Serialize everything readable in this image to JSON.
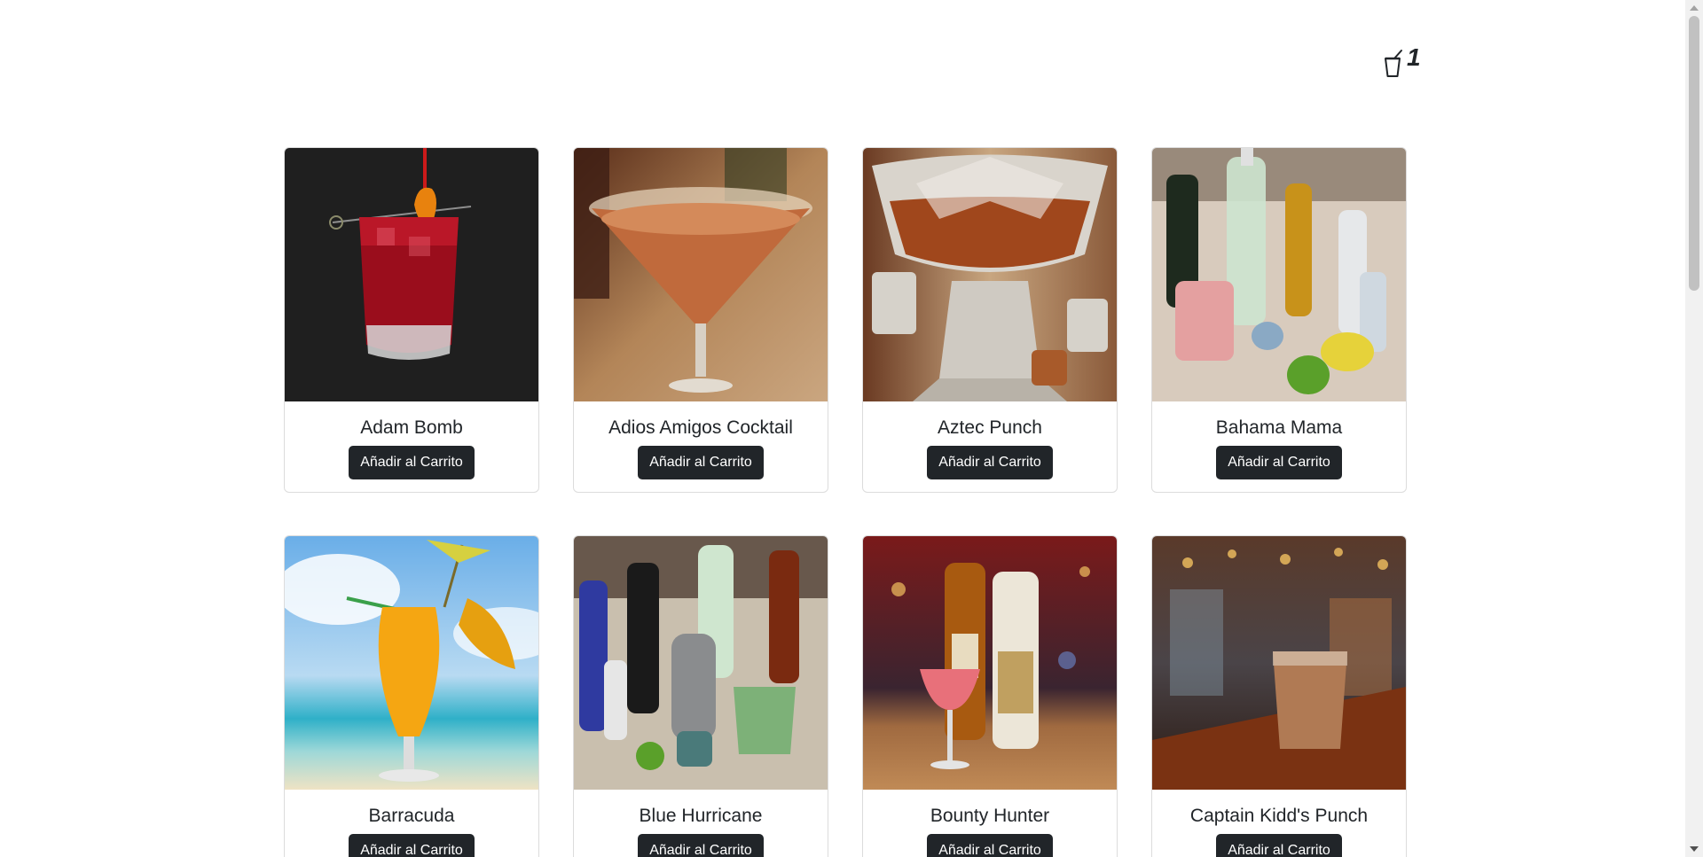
{
  "cart": {
    "icon": "cup-icon",
    "count": "1"
  },
  "add_button_label": "Añadir al Carrito",
  "products": [
    {
      "name": "Adam Bomb",
      "image": "red cocktail in rocks glass with orange peel on skewer, black background"
    },
    {
      "name": "Adios Amigos Cocktail",
      "image": "orange cocktail in martini glass"
    },
    {
      "name": "Aztec Punch",
      "image": "crystal punch bowl with cups"
    },
    {
      "name": "Bahama Mama",
      "image": "bottles of rum and liqueur with pink drink and lemons"
    },
    {
      "name": "Barracuda",
      "image": "yellow drink in hurricane glass with pineapple on beach"
    },
    {
      "name": "Blue Hurricane",
      "image": "liquor bottles, shaker and green glass"
    },
    {
      "name": "Bounty Hunter",
      "image": "pink cocktail with rum and coconut bottles on bar"
    },
    {
      "name": "Captain Kidd's Punch",
      "image": "brown drink in glass on bar with bokeh lights"
    }
  ],
  "colors": {
    "button_bg": "#212529",
    "button_text": "#ffffff",
    "card_border": "#dcdcdc",
    "page_bg": "#ffffff"
  }
}
